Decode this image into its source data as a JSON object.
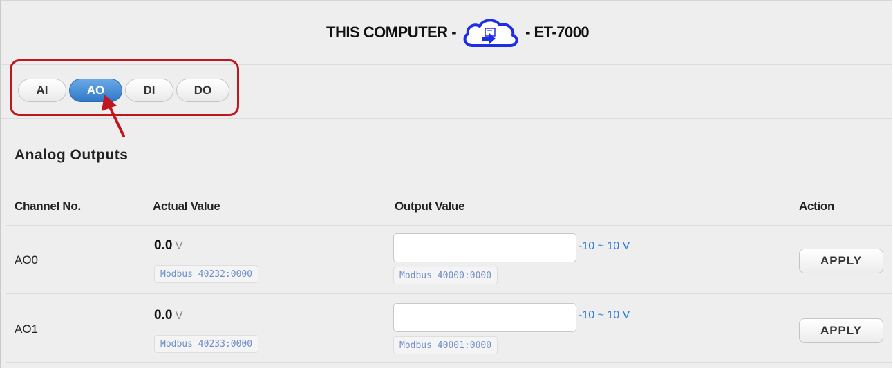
{
  "header": {
    "left_text": "THIS COMPUTER -",
    "right_text": "- ET-7000",
    "cloud_icon": "cloud-transfer-icon",
    "cloud_color": "#1e2ee6"
  },
  "tabs": [
    {
      "label": "AI",
      "active": false
    },
    {
      "label": "AO",
      "active": true
    },
    {
      "label": "DI",
      "active": false
    },
    {
      "label": "DO",
      "active": false
    }
  ],
  "highlight_color": "#c0171e",
  "accent_color": "#2f78c7",
  "section_title": "Analog Outputs",
  "table": {
    "columns": [
      "Channel No.",
      "Actual Value",
      "Output Value",
      "Action"
    ],
    "rows": [
      {
        "channel": "AO0",
        "actual": "0.0",
        "unit": "V",
        "actual_modbus": "Modbus 40232:0000",
        "output_value": "",
        "output_modbus": "Modbus 40000:0000",
        "range": "-10 ~ 10 V",
        "action": "APPLY"
      },
      {
        "channel": "AO1",
        "actual": "0.0",
        "unit": "V",
        "actual_modbus": "Modbus 40233:0000",
        "output_value": "",
        "output_modbus": "Modbus 40001:0000",
        "range": "-10 ~ 10 V",
        "action": "APPLY"
      }
    ]
  }
}
